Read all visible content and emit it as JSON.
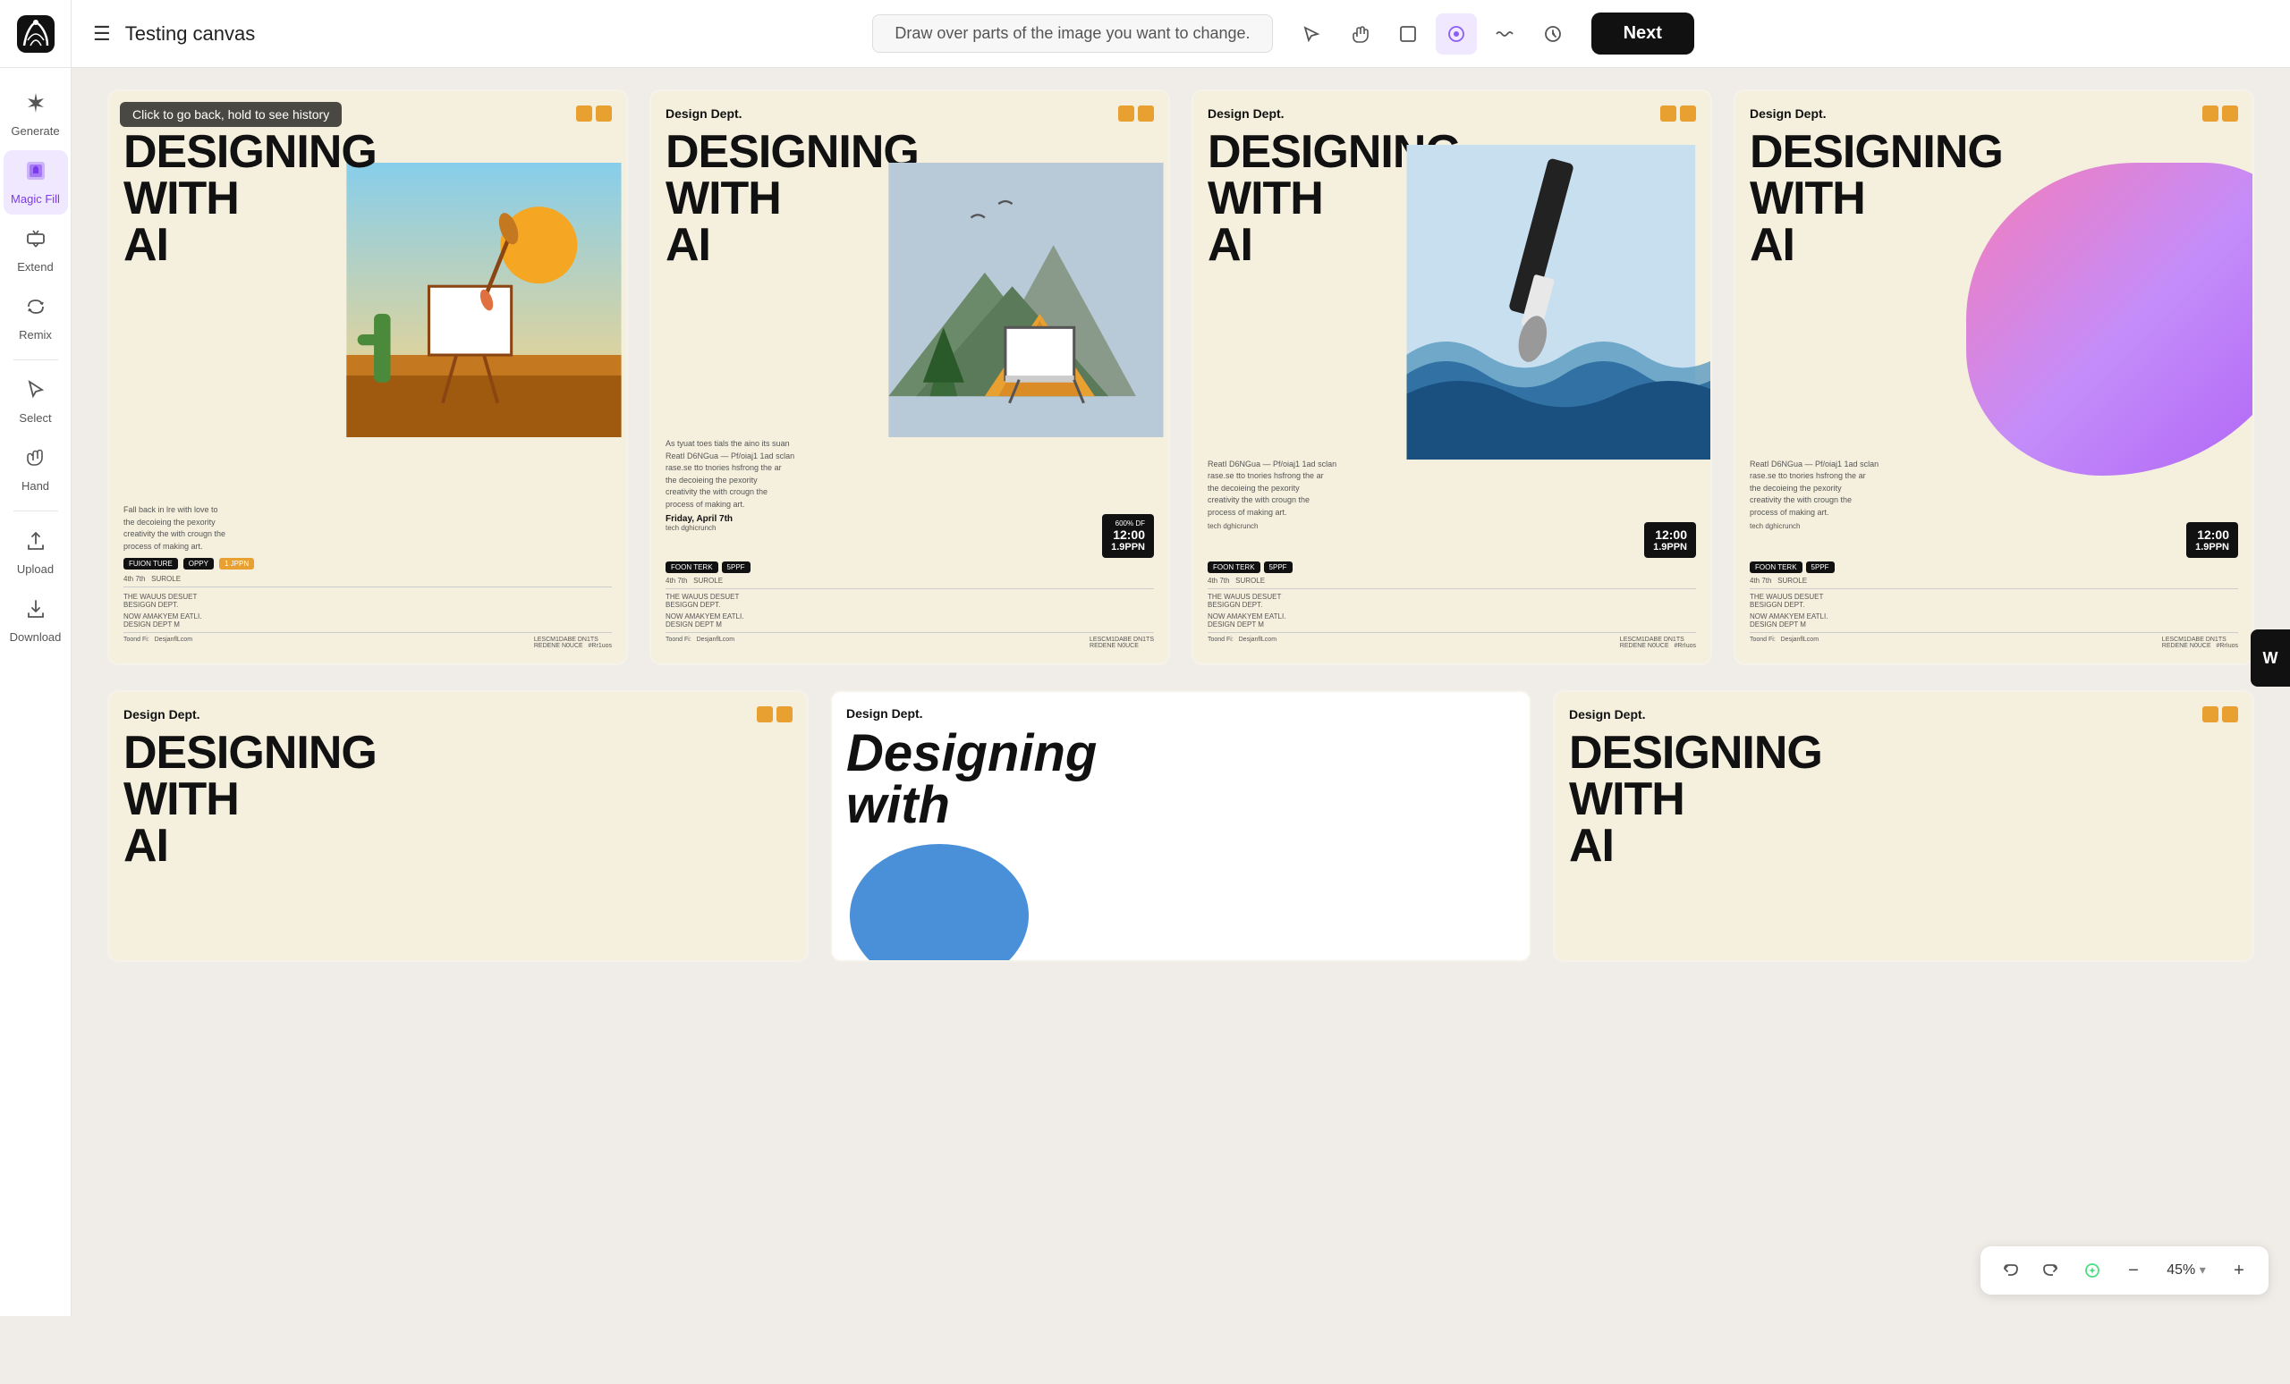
{
  "topbar": {
    "title": "Testing canvas",
    "instruction": "Draw over parts of the image you want to change.",
    "next_label": "Next"
  },
  "sidebar": {
    "items": [
      {
        "id": "generate",
        "label": "Generate",
        "icon": "✦"
      },
      {
        "id": "magic-fill",
        "label": "Magic Fill",
        "icon": "⬛",
        "active": true
      },
      {
        "id": "extend",
        "label": "Extend",
        "icon": "⤢"
      },
      {
        "id": "remix",
        "label": "Remix",
        "icon": "⟳"
      },
      {
        "id": "select",
        "label": "Select",
        "icon": "↖"
      },
      {
        "id": "hand",
        "label": "Hand",
        "icon": "✋"
      },
      {
        "id": "upload",
        "label": "Upload",
        "icon": "⬆"
      },
      {
        "id": "download",
        "label": "Download",
        "icon": "⬇"
      }
    ]
  },
  "canvas": {
    "tooltip": "Click to go back, hold to see history",
    "cards": [
      {
        "id": "card1",
        "brand": "",
        "title": "DESIGNING WITH AI",
        "style": "desert"
      },
      {
        "id": "card2",
        "brand": "Design Dept.",
        "title": "DESIGNING WITH AI",
        "style": "forest"
      },
      {
        "id": "card3",
        "brand": "Design Dept.",
        "title": "DESIGNING WITH AI",
        "style": "wave"
      },
      {
        "id": "card4",
        "brand": "Design Dept.",
        "title": "DESIGNING WITH AI",
        "style": "pink"
      }
    ],
    "cards_bottom": [
      {
        "id": "card5",
        "brand": "Design Dept.",
        "title": "DESIGNING WITH AI",
        "style": "desert2"
      },
      {
        "id": "card6",
        "brand": "Design Dept.",
        "title": "Designing with",
        "style": "bw"
      },
      {
        "id": "card7",
        "brand": "Design Dept.",
        "title": "DESIGNING WITH AI",
        "style": "blue"
      }
    ]
  },
  "zoom": {
    "level": "45%",
    "decrease": "−",
    "increase": "+"
  },
  "w_button": "W",
  "tools": [
    {
      "id": "arrow",
      "icon": "↗",
      "active": false
    },
    {
      "id": "hand",
      "icon": "✋",
      "active": false
    },
    {
      "id": "rect",
      "icon": "⬜",
      "active": false
    },
    {
      "id": "brush",
      "icon": "◯",
      "active": true
    },
    {
      "id": "wave",
      "icon": "〜",
      "active": false
    },
    {
      "id": "history",
      "icon": "⏰",
      "active": false
    }
  ]
}
